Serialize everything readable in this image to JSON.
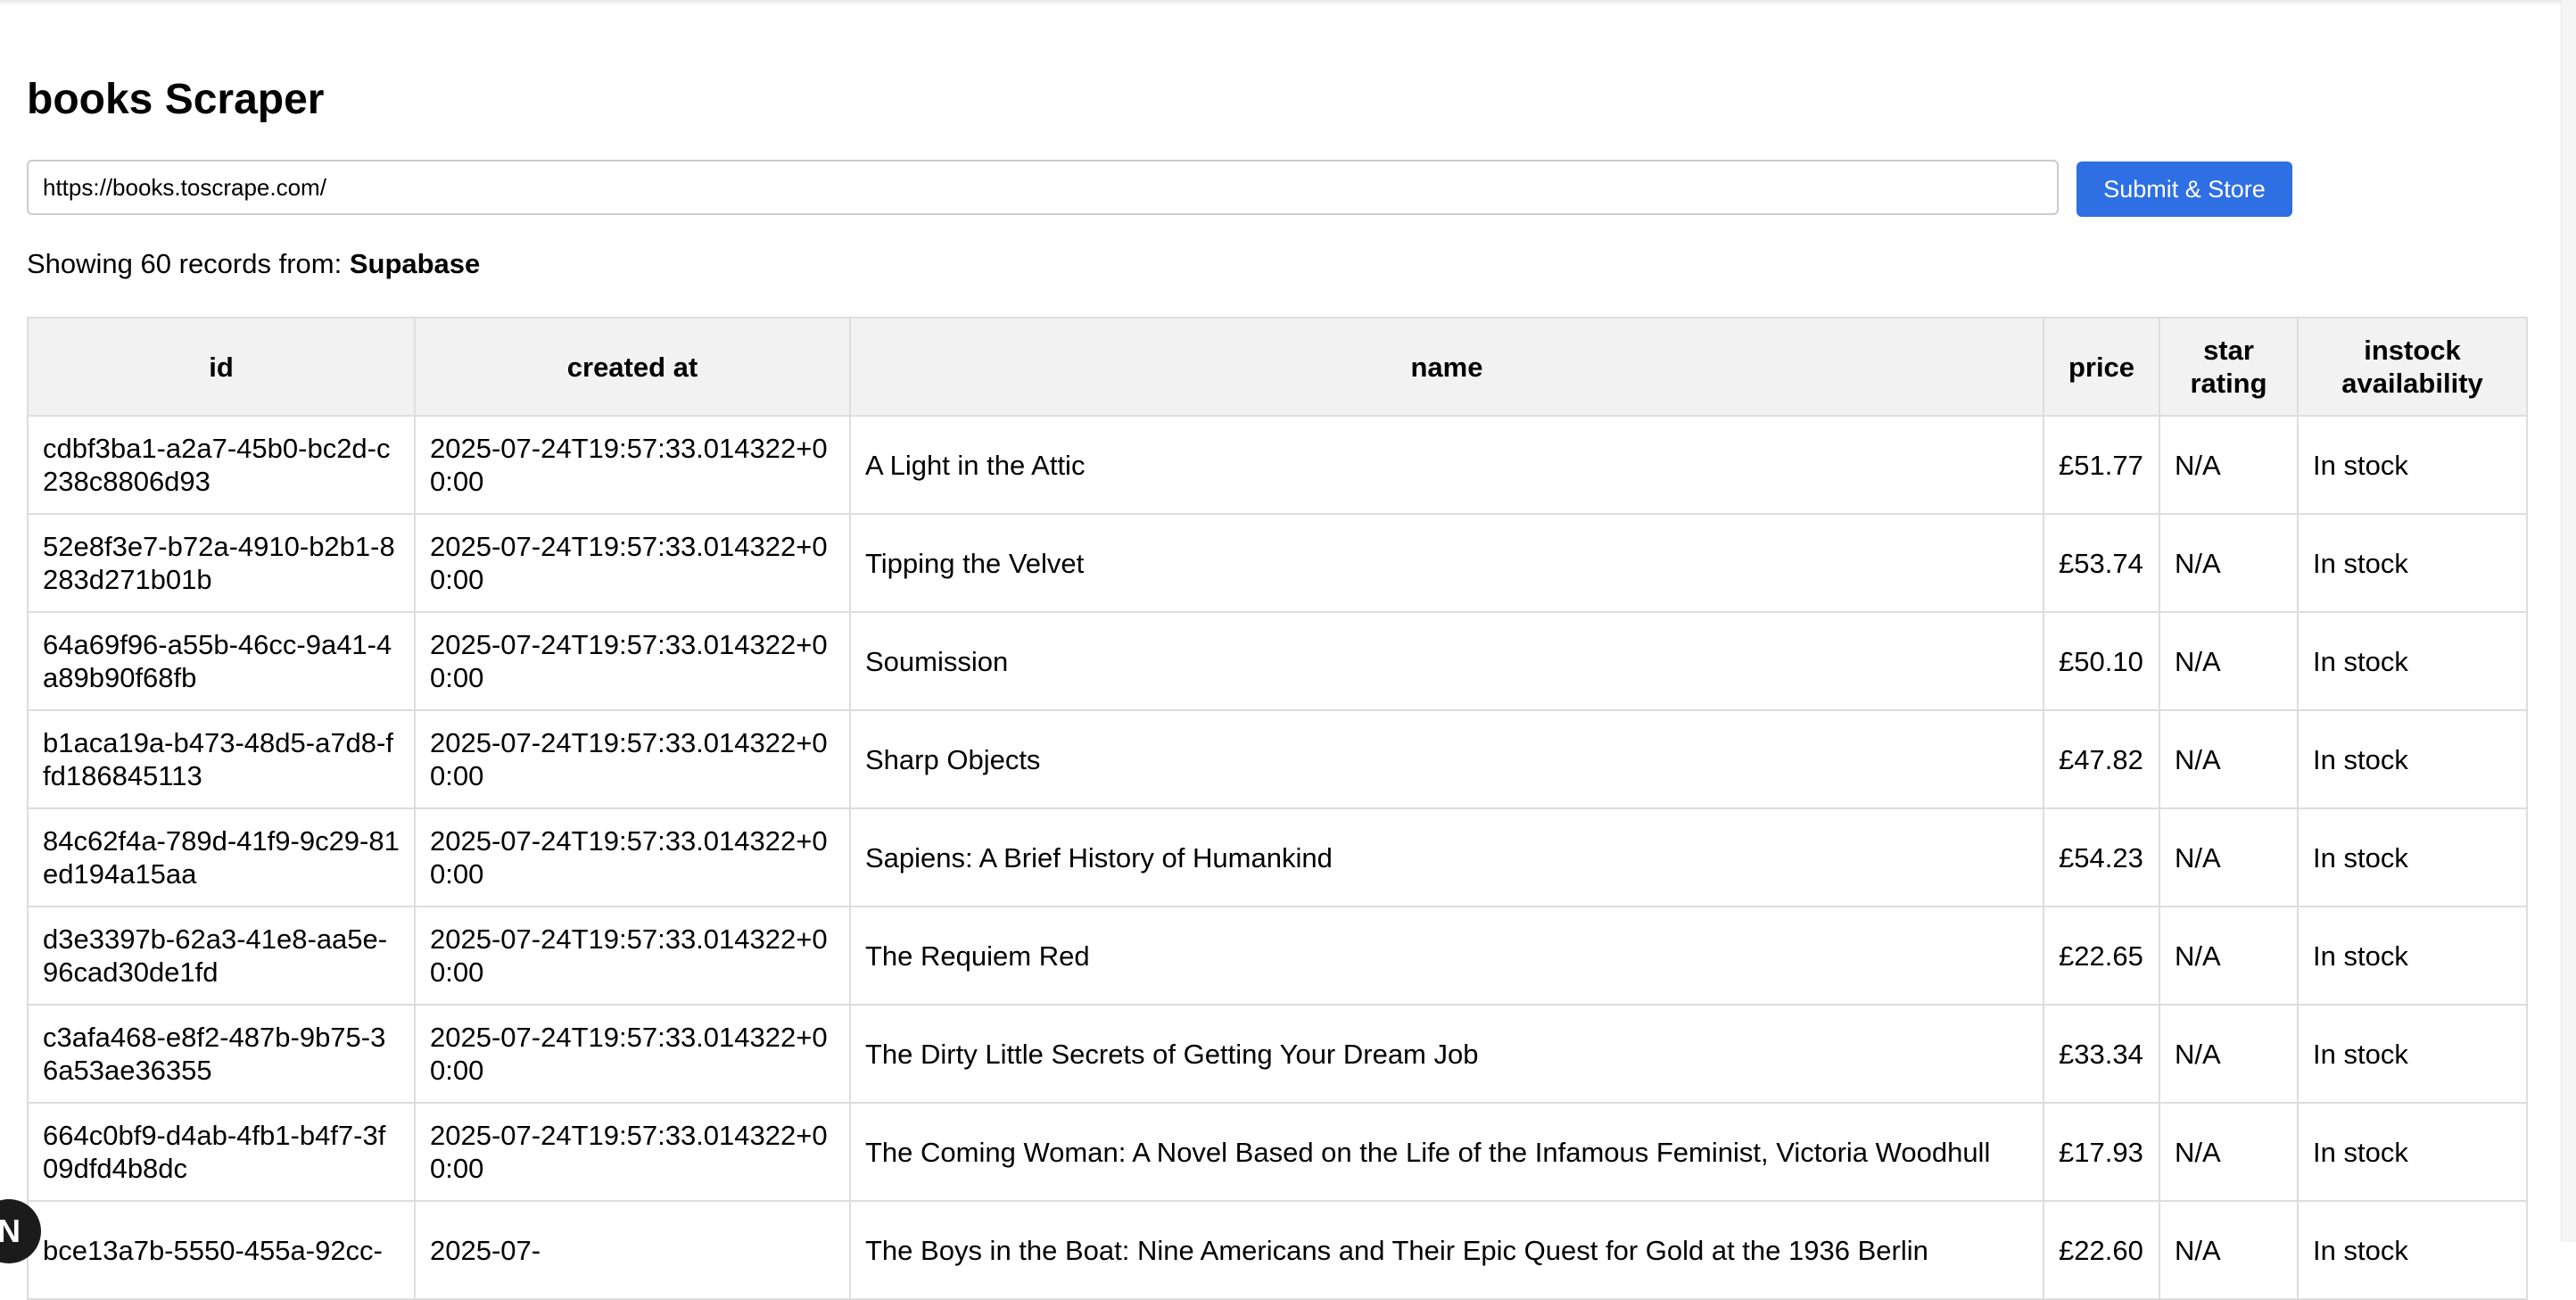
{
  "app": {
    "title": "books Scraper"
  },
  "form": {
    "url_value": "https://books.toscrape.com/",
    "submit_label": "Submit & Store"
  },
  "status": {
    "prefix": "Showing 60 records from: ",
    "source": "Supabase"
  },
  "table": {
    "columns": [
      "id",
      "created at",
      "name",
      "price",
      "star rating",
      "instock availability"
    ],
    "rows": [
      {
        "id": "cdbf3ba1-a2a7-45b0-bc2d-c238c8806d93",
        "created_at": "2025-07-24T19:57:33.014322+00:00",
        "name": "A Light in the Attic",
        "price": "£51.77",
        "star_rating": "N/A",
        "availability": "In stock"
      },
      {
        "id": "52e8f3e7-b72a-4910-b2b1-8283d271b01b",
        "created_at": "2025-07-24T19:57:33.014322+00:00",
        "name": "Tipping the Velvet",
        "price": "£53.74",
        "star_rating": "N/A",
        "availability": "In stock"
      },
      {
        "id": "64a69f96-a55b-46cc-9a41-4a89b90f68fb",
        "created_at": "2025-07-24T19:57:33.014322+00:00",
        "name": "Soumission",
        "price": "£50.10",
        "star_rating": "N/A",
        "availability": "In stock"
      },
      {
        "id": "b1aca19a-b473-48d5-a7d8-ffd186845113",
        "created_at": "2025-07-24T19:57:33.014322+00:00",
        "name": "Sharp Objects",
        "price": "£47.82",
        "star_rating": "N/A",
        "availability": "In stock"
      },
      {
        "id": "84c62f4a-789d-41f9-9c29-81ed194a15aa",
        "created_at": "2025-07-24T19:57:33.014322+00:00",
        "name": "Sapiens: A Brief History of Humankind",
        "price": "£54.23",
        "star_rating": "N/A",
        "availability": "In stock"
      },
      {
        "id": "d3e3397b-62a3-41e8-aa5e-96cad30de1fd",
        "created_at": "2025-07-24T19:57:33.014322+00:00",
        "name": "The Requiem Red",
        "price": "£22.65",
        "star_rating": "N/A",
        "availability": "In stock"
      },
      {
        "id": "c3afa468-e8f2-487b-9b75-36a53ae36355",
        "created_at": "2025-07-24T19:57:33.014322+00:00",
        "name": "The Dirty Little Secrets of Getting Your Dream Job",
        "price": "£33.34",
        "star_rating": "N/A",
        "availability": "In stock"
      },
      {
        "id": "664c0bf9-d4ab-4fb1-b4f7-3f09dfd4b8dc",
        "created_at": "2025-07-24T19:57:33.014322+00:00",
        "name": "The Coming Woman: A Novel Based on the Life of the Infamous Feminist, Victoria Woodhull",
        "price": "£17.93",
        "star_rating": "N/A",
        "availability": "In stock"
      },
      {
        "id": "bce13a7b-5550-455a-92cc-",
        "created_at": "2025-07-",
        "name": "The Boys in the Boat: Nine Americans and Their Epic Quest for Gold at the 1936 Berlin",
        "price": "£22.60",
        "star_rating": "N/A",
        "availability": "In stock"
      }
    ]
  },
  "badge": {
    "letter": "N"
  },
  "colors": {
    "accent": "#2f6fe4",
    "header_bg": "#f2f2f2",
    "border": "#dddddd"
  }
}
